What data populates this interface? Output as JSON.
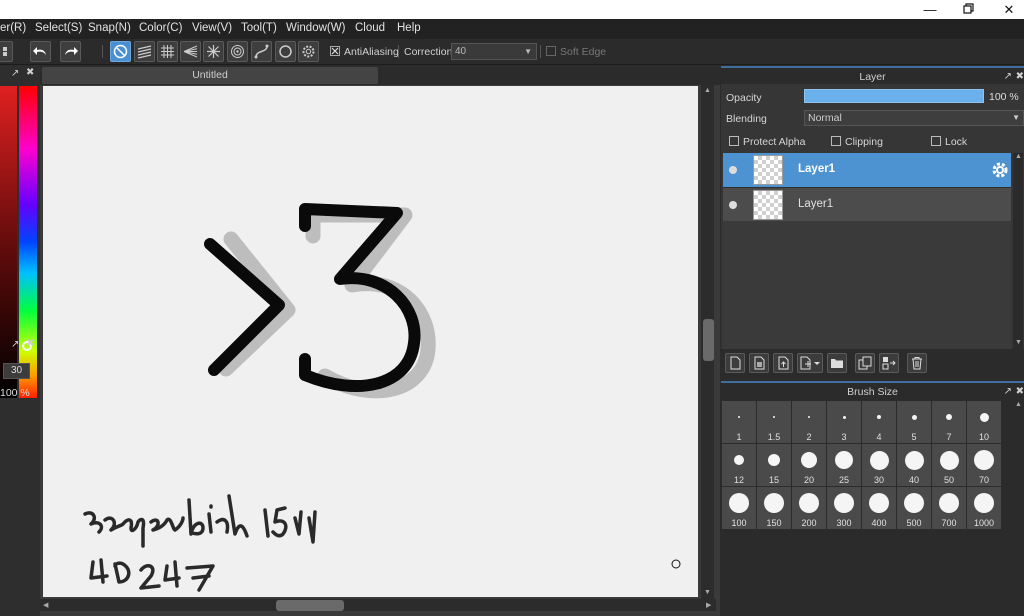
{
  "window": {
    "minimize_icon": "minimize-icon",
    "maximize_icon": "restore-icon",
    "close_icon": "close-icon"
  },
  "menu": {
    "items": [
      "er(R)",
      "Select(S)",
      "Snap(N)",
      "Color(C)",
      "View(V)",
      "Tool(T)",
      "Window(W)",
      "Cloud",
      "Help"
    ]
  },
  "toolbar": {
    "antialiasing_label": "AntiAliasing",
    "correction_label": "Correction",
    "correction_value": "40",
    "soft_edge_label": "Soft Edge",
    "antialiasing_checked": true,
    "soft_edge_checked": false
  },
  "brush": {
    "size_value": "30",
    "opacity_text": "100 %"
  },
  "document": {
    "tab_title": "Untitled"
  },
  "layer_panel": {
    "title": "Layer",
    "opacity_label": "Opacity",
    "opacity_value": "100 %",
    "opacity_fraction": 1.0,
    "blending_label": "Blending",
    "blending_value": "Normal",
    "protect_alpha_label": "Protect Alpha",
    "clipping_label": "Clipping",
    "lock_label": "Lock",
    "layers": [
      {
        "name": "Layer1",
        "selected": true
      },
      {
        "name": "Layer1",
        "selected": false
      }
    ]
  },
  "brush_size_panel": {
    "title": "Brush Size",
    "sizes": [
      "1",
      "1.5",
      "2",
      "3",
      "4",
      "5",
      "7",
      "10",
      "12",
      "15",
      "20",
      "25",
      "30",
      "40",
      "50",
      "70",
      "100",
      "150",
      "200",
      "300",
      "400",
      "500",
      "700",
      "1000"
    ]
  },
  "colors": {
    "accent": "#4e93d1",
    "panel_bg": "#2b2b2b",
    "canvas_bg": "#f0f0f0"
  }
}
